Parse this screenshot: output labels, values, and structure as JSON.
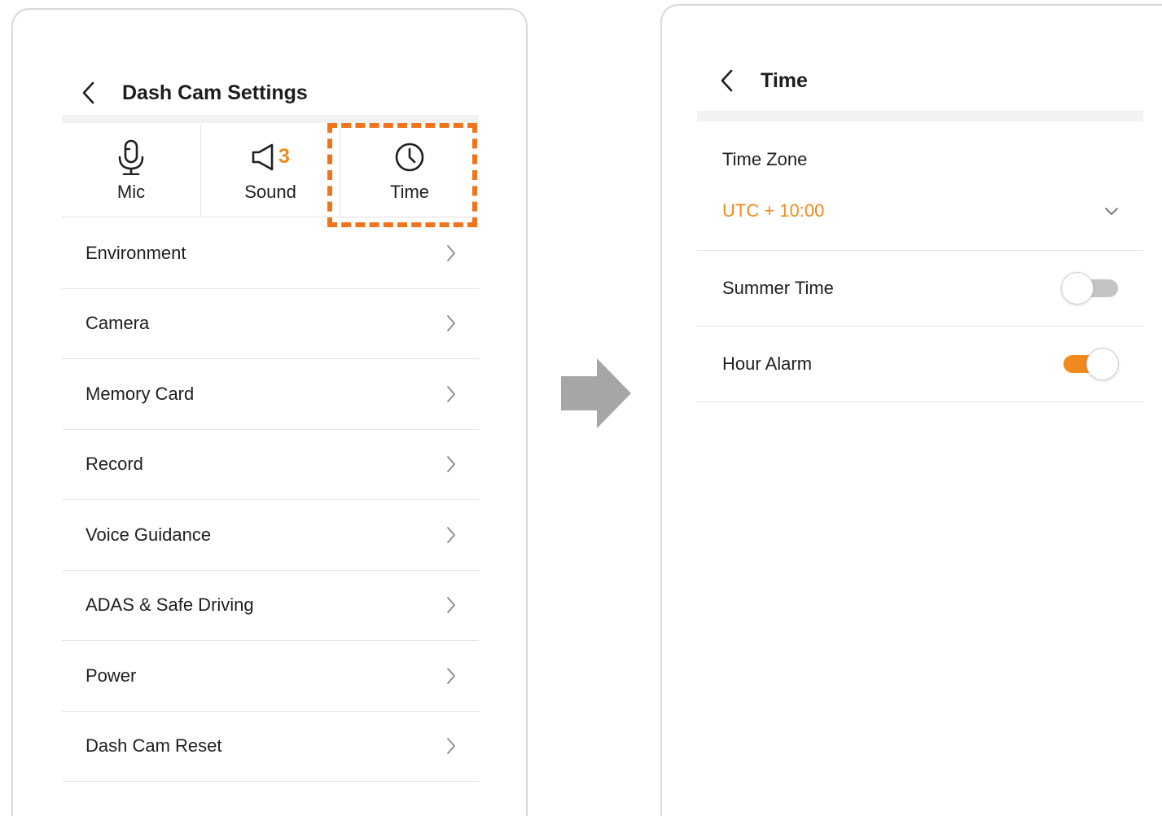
{
  "left_panel": {
    "title": "Dash Cam Settings",
    "tabs": [
      {
        "label": "Mic",
        "icon": "mic-icon"
      },
      {
        "label": "Sound",
        "icon": "speaker-icon",
        "badge": "3"
      },
      {
        "label": "Time",
        "icon": "clock-icon"
      }
    ],
    "menu": [
      {
        "label": "Environment"
      },
      {
        "label": "Camera"
      },
      {
        "label": "Memory Card"
      },
      {
        "label": "Record"
      },
      {
        "label": "Voice Guidance"
      },
      {
        "label": "ADAS & Safe Driving"
      },
      {
        "label": "Power"
      },
      {
        "label": "Dash Cam Reset"
      }
    ]
  },
  "right_panel": {
    "title": "Time",
    "time_zone": {
      "label": "Time Zone",
      "value": "UTC + 10:00"
    },
    "summer_time": {
      "label": "Summer Time",
      "enabled": false
    },
    "hour_alarm": {
      "label": "Hour Alarm",
      "enabled": true
    }
  },
  "colors": {
    "accent": "#f08a1f",
    "highlight": "#f0731d",
    "arrow": "#a6a6a6"
  }
}
